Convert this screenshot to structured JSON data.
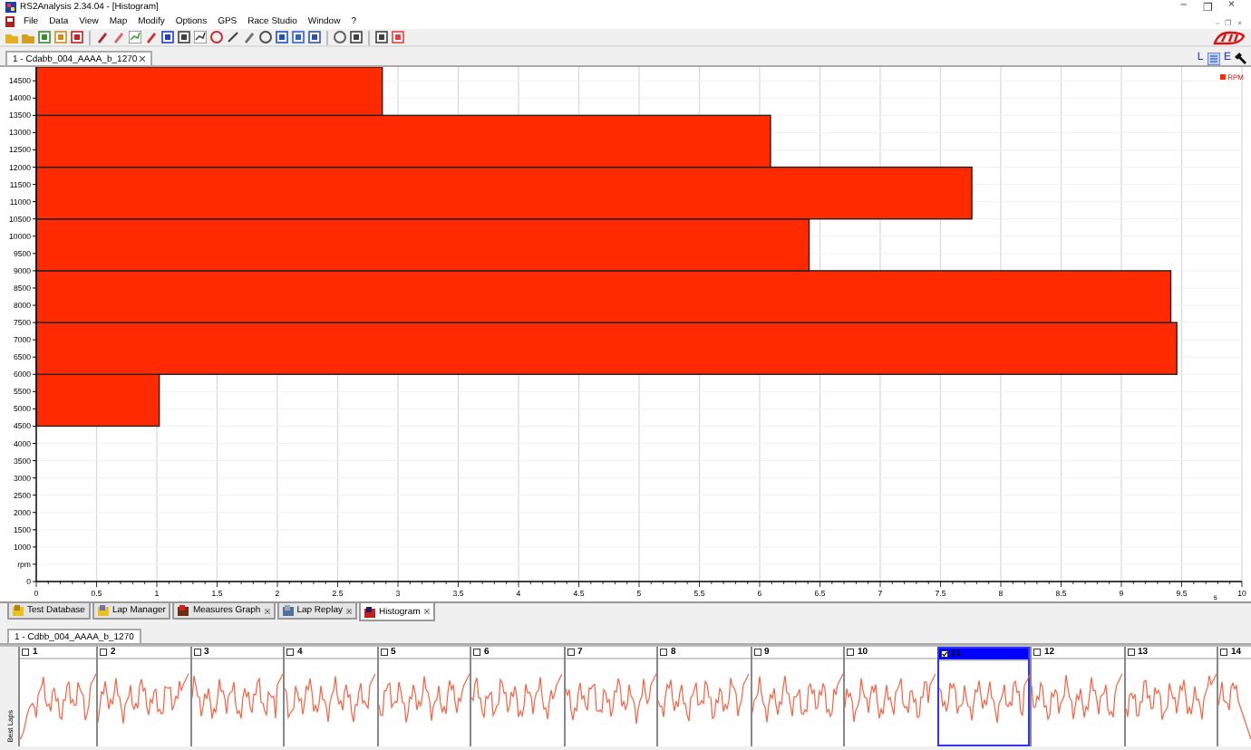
{
  "window": {
    "title": "RS2Analysis 2.34.04 - [Histogram]",
    "controls": [
      "–",
      "❐",
      "×"
    ]
  },
  "menu": {
    "items": [
      "File",
      "Data",
      "View",
      "Map",
      "Modify",
      "Options",
      "GPS",
      "Race Studio",
      "Window",
      "?"
    ],
    "mdi_controls": [
      "–",
      "❐",
      "×"
    ]
  },
  "document_tab": {
    "label": "1 - Cdabb_004_AAAA_b_1270"
  },
  "view_buttons": [
    {
      "kind": "text",
      "label": "L"
    },
    {
      "kind": "list"
    },
    {
      "kind": "text",
      "label": "E"
    },
    {
      "kind": "wrench"
    }
  ],
  "chart": {
    "legend": "RPM",
    "chart_data": {
      "type": "bar",
      "orientation": "horizontal",
      "xlabel": "s",
      "grid": true,
      "x": [
        5250,
        6750,
        8250,
        9750,
        11250,
        12750,
        14250
      ],
      "values": [
        1.02,
        9.46,
        9.41,
        6.41,
        7.76,
        6.09,
        2.87
      ],
      "xlim": [
        0,
        10
      ],
      "ylim": [
        0,
        14900
      ],
      "xticks": [
        0,
        {
          "value": 0.5,
          "label": "0.5"
        },
        1,
        {
          "value": 1.5,
          "label": "1.5"
        },
        2,
        {
          "value": 2.5,
          "label": "2.5"
        },
        3,
        {
          "value": 3.5,
          "label": "3.5"
        },
        4,
        {
          "value": 4.5,
          "label": "4.5"
        },
        5,
        {
          "value": 5.5,
          "label": "5.5"
        },
        6,
        {
          "value": 6.5,
          "label": "6.5"
        },
        7,
        {
          "value": 7.5,
          "label": "7.5"
        },
        8,
        {
          "value": 8.5,
          "label": "8.5"
        },
        9,
        {
          "value": 9.5,
          "label": "9.5"
        },
        10
      ],
      "yticks": [
        0,
        {
          "value": 500,
          "label": "rpm"
        },
        1000,
        1500,
        2000,
        2500,
        3000,
        3500,
        4000,
        4500,
        5000,
        5500,
        6000,
        6500,
        7000,
        7500,
        8000,
        8500,
        9000,
        9500,
        10000,
        10500,
        11000,
        11500,
        12000,
        12500,
        13000,
        13500,
        14000,
        14500
      ]
    }
  },
  "bottom_tabs": [
    {
      "label": "Test Database",
      "selected": false,
      "closable": false
    },
    {
      "label": "Lap Manager",
      "selected": false,
      "closable": false
    },
    {
      "label": "Measures Graph",
      "selected": false,
      "closable": true
    },
    {
      "label": "Lap Replay",
      "selected": false,
      "closable": true
    },
    {
      "label": "Histogram",
      "selected": true,
      "closable": true
    }
  ],
  "lap_document_tab": {
    "label": "1 - Cdbb_004_AAAA_b_1270"
  },
  "lap_strip": {
    "side_label": "Best Laps",
    "laps": [
      {
        "label": "1",
        "checked": false,
        "selected": false
      },
      {
        "label": "2",
        "checked": false,
        "selected": false
      },
      {
        "label": "3",
        "checked": false,
        "selected": false
      },
      {
        "label": "4",
        "checked": false,
        "selected": false
      },
      {
        "label": "5",
        "checked": false,
        "selected": false
      },
      {
        "label": "6",
        "checked": false,
        "selected": false
      },
      {
        "label": "7",
        "checked": false,
        "selected": false
      },
      {
        "label": "8",
        "checked": false,
        "selected": false
      },
      {
        "label": "9",
        "checked": false,
        "selected": false
      },
      {
        "label": "10",
        "checked": false,
        "selected": false
      },
      {
        "label": "11",
        "checked": true,
        "selected": true
      },
      {
        "label": "12",
        "checked": false,
        "selected": false
      },
      {
        "label": "13",
        "checked": false,
        "selected": false
      },
      {
        "label": "14",
        "checked": false,
        "selected": false
      }
    ]
  }
}
